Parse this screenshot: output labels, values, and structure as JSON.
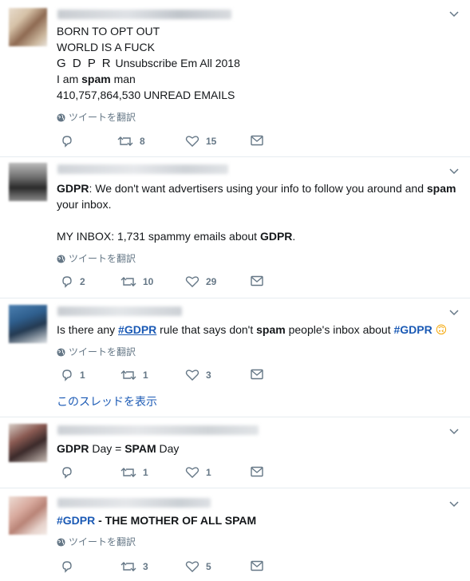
{
  "translate_label": "ツイートを翻訳",
  "thread_link": "このスレッドを表示",
  "tweets": [
    {
      "lines": {
        "l1": "BORN TO OPT OUT",
        "l2": "WORLD IS A FUCK",
        "l3a": "G D P R",
        "l3b": " Unsubscribe Em All 2018",
        "l4a": "I am ",
        "l4b": "spam",
        "l4c": " man",
        "l5": "410,757,864,530 UNREAD EMAILS"
      },
      "retweets": "8",
      "likes": "15"
    },
    {
      "lines": {
        "l1a": "GDPR",
        "l1b": ": We don't want advertisers using your info to follow you around and ",
        "l1c": "spam",
        "l2": "your inbox.",
        "l3a": "MY INBOX: 1,731 spammy emails about ",
        "l3b": "GDPR",
        "l3c": "."
      },
      "replies": "2",
      "retweets": "10",
      "likes": "29"
    },
    {
      "lines": {
        "a": "Is there any ",
        "b": "#GDPR",
        "c": " rule that says don't ",
        "d": "spam",
        "e": " people's inbox about ",
        "f": "#GDPR",
        "emoji": "🙃"
      },
      "replies": "1",
      "retweets": "1",
      "likes": "3"
    },
    {
      "lines": {
        "a": "GDPR",
        "b": " Day = ",
        "c": "SPAM",
        "d": " Day"
      },
      "retweets": "1",
      "likes": "1"
    },
    {
      "lines": {
        "a": "#GDPR",
        "b": " - THE MOTHER OF ALL ",
        "c": "SPAM"
      },
      "retweets": "3",
      "likes": "5"
    }
  ],
  "colors": {
    "link": "#1b5ab5",
    "muted": "#657786",
    "divider": "#e6ecf0"
  }
}
